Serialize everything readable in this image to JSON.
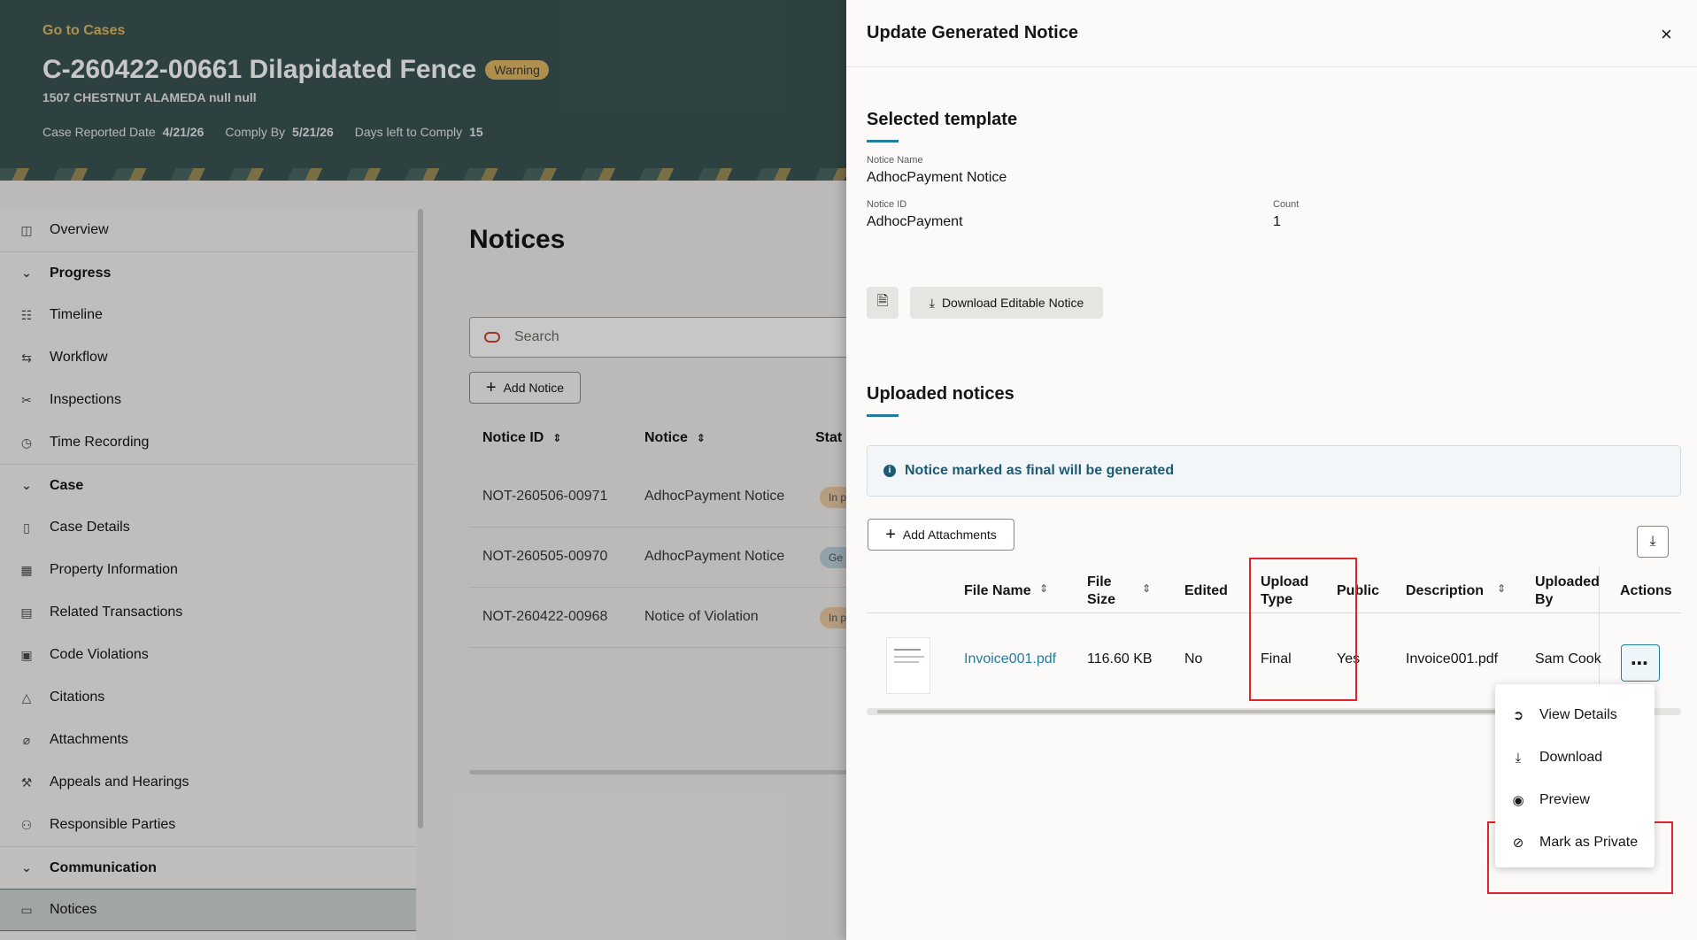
{
  "hero": {
    "go_to_cases": "Go to Cases",
    "case_title": "C-260422-00661 Dilapidated Fence",
    "badge": "Warning",
    "address": "1507 CHESTNUT ALAMEDA null null",
    "reported_label": "Case Reported Date",
    "reported_value": "4/21/26",
    "comply_label": "Comply By",
    "comply_value": "5/21/26",
    "days_label": "Days left to Comply",
    "days_value": "15"
  },
  "sidebar": {
    "items": [
      {
        "label": "Overview",
        "icon": "overview-icon"
      },
      {
        "label": "Progress",
        "icon": "chevron-down-icon"
      },
      {
        "label": "Timeline",
        "icon": "timeline-icon"
      },
      {
        "label": "Workflow",
        "icon": "workflow-icon"
      },
      {
        "label": "Inspections",
        "icon": "inspections-icon"
      },
      {
        "label": "Time Recording",
        "icon": "clock-icon"
      },
      {
        "label": "Case",
        "icon": "chevron-down-icon"
      },
      {
        "label": "Case Details",
        "icon": "document-icon"
      },
      {
        "label": "Property Information",
        "icon": "building-icon"
      },
      {
        "label": "Related Transactions",
        "icon": "transactions-icon"
      },
      {
        "label": "Code Violations",
        "icon": "violations-icon"
      },
      {
        "label": "Citations",
        "icon": "warning-icon"
      },
      {
        "label": "Attachments",
        "icon": "paperclip-icon"
      },
      {
        "label": "Appeals and Hearings",
        "icon": "gavel-icon"
      },
      {
        "label": "Responsible Parties",
        "icon": "people-icon"
      },
      {
        "label": "Communication",
        "icon": "chevron-down-icon"
      },
      {
        "label": "Notices",
        "icon": "notice-icon"
      }
    ]
  },
  "notices": {
    "title": "Notices",
    "search_placeholder": "Search",
    "add_label": "Add Notice",
    "col_id": "Notice ID",
    "col_notice": "Notice",
    "col_status": "Stat",
    "rows": [
      {
        "id": "NOT-260506-00971",
        "notice": "AdhocPayment Notice",
        "status": "In p"
      },
      {
        "id": "NOT-260505-00970",
        "notice": "AdhocPayment Notice",
        "status": "Ge"
      },
      {
        "id": "NOT-260422-00968",
        "notice": "Notice of Violation",
        "status": "In p"
      }
    ]
  },
  "drawer": {
    "title": "Update Generated Notice",
    "close_icon": "×",
    "selected_title": "Selected template",
    "notice_name_label": "Notice Name",
    "notice_name_value": "AdhocPayment Notice",
    "notice_id_label": "Notice ID",
    "notice_id_value": "AdhocPayment",
    "count_label": "Count",
    "count_value": "1",
    "download_editable": "Download Editable Notice",
    "uploaded_title": "Uploaded notices",
    "info_text": "Notice marked as final will be generated",
    "add_attachments": "Add Attachments",
    "table": {
      "headers": {
        "file_name": "File Name",
        "file_size_1": "File",
        "file_size_2": "Size",
        "edited": "Edited",
        "upload_type_1": "Upload",
        "upload_type_2": "Type",
        "public": "Public",
        "description": "Description",
        "uploaded_by_1": "Uploaded",
        "uploaded_by_2": "By",
        "actions": "Actions"
      },
      "row": {
        "file_name": "Invoice001.pdf",
        "file_size": "116.60 KB",
        "edited": "No",
        "upload_type": "Final",
        "public": "Yes",
        "description": "Invoice001.pdf",
        "uploaded_by": "Sam Cook",
        "more": "⋯"
      }
    },
    "menu": [
      {
        "label": "View Details",
        "icon": "arrow-circle-icon"
      },
      {
        "label": "Download",
        "icon": "download-icon"
      },
      {
        "label": "Preview",
        "icon": "eye-icon"
      },
      {
        "label": "Mark as Private",
        "icon": "eye-off-icon"
      }
    ]
  },
  "colors": {
    "hero_bg": "#3a5553",
    "accent_gold": "#e0b862",
    "link_teal": "#227e9e",
    "highlight_red": "#e0242b"
  }
}
